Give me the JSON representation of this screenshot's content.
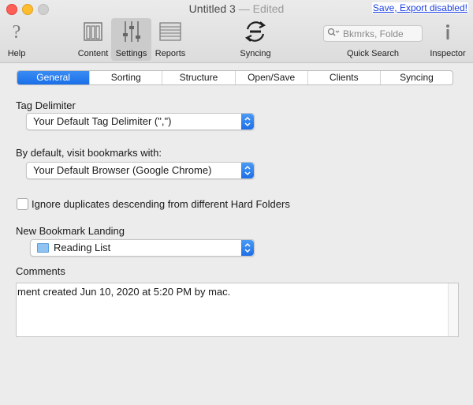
{
  "window": {
    "title": "Untitled 3",
    "separator": "—",
    "status": "Edited",
    "save_link": "Save, Export disabled!"
  },
  "toolbar": {
    "help": "Help",
    "content": "Content",
    "settings": "Settings",
    "reports": "Reports",
    "syncing": "Syncing",
    "quick_search": "Quick Search",
    "quick_search_placeholder": "Bkmrks, Folde",
    "inspector": "Inspector"
  },
  "tabs": [
    {
      "label": "General",
      "active": true
    },
    {
      "label": "Sorting",
      "active": false
    },
    {
      "label": "Structure",
      "active": false
    },
    {
      "label": "Open/Save",
      "active": false
    },
    {
      "label": "Clients",
      "active": false
    },
    {
      "label": "Syncing",
      "active": false
    }
  ],
  "general": {
    "tag_delimiter_label": "Tag Delimiter",
    "tag_delimiter_value": "Your Default Tag Delimiter (\",\")",
    "visit_label": "By default, visit bookmarks with:",
    "visit_value": "Your Default Browser (Google Chrome)",
    "ignore_duplicates_label": "Ignore duplicates descending from different Hard Folders",
    "ignore_duplicates_checked": false,
    "landing_label": "New Bookmark Landing",
    "landing_value": "Reading List",
    "comments_label": "Comments",
    "comments_value": "ment created Jun 10, 2020 at 5:20 PM by mac."
  },
  "colors": {
    "accent": "#1a6fe8",
    "link": "#1b3fe0",
    "close": "#fe5f57",
    "minimize": "#febc2e"
  }
}
